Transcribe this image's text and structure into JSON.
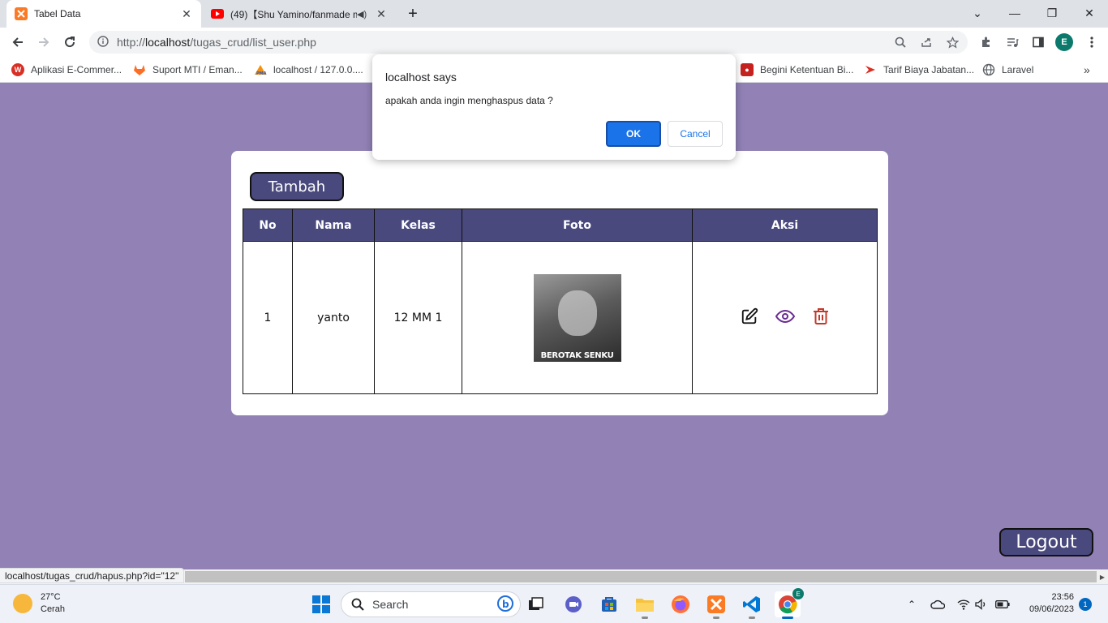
{
  "browser": {
    "tabs": [
      {
        "title": "Tabel Data",
        "favicon": "xampp-icon",
        "active": true
      },
      {
        "title": "(49)【Shu Yamino/fanmade m",
        "favicon": "youtube-icon",
        "active": false
      }
    ],
    "address": {
      "prefix": "http://",
      "host": "localhost",
      "path": "/tugas_crud/list_user.php"
    },
    "profile_initial": "E",
    "bookmarks": [
      {
        "label": "Aplikasi E-Commer...",
        "icon": "ecommerce-icon",
        "color": "#d93025"
      },
      {
        "label": "Suport MTI / Eman...",
        "icon": "gitlab-icon",
        "color": "#fc6d26"
      },
      {
        "label": "localhost / 127.0.0....",
        "icon": "phpmyadmin-icon",
        "color": "#f29111"
      },
      {
        "label": "Begini Ketentuan Bi...",
        "icon": "news-icon",
        "color": "#c5221f"
      },
      {
        "label": "Tarif Biaya Jabatan...",
        "icon": "arrow-bookmark-icon",
        "color": "#d93025"
      },
      {
        "label": "Laravel",
        "icon": "globe-icon",
        "color": "#5f6368"
      }
    ]
  },
  "dialog": {
    "title": "localhost says",
    "message": "apakah anda ingin menghaspus data ?",
    "ok_label": "OK",
    "cancel_label": "Cancel"
  },
  "page": {
    "add_button": "Tambah",
    "logout_button": "Logout",
    "table": {
      "headers": [
        "No",
        "Nama",
        "Kelas",
        "Foto",
        "Aksi"
      ],
      "rows": [
        {
          "no": "1",
          "nama": "yanto",
          "kelas": "12 MM 1",
          "photo_caption": "BEROTAK SENKU"
        }
      ]
    },
    "colors": {
      "background": "#9181b5",
      "accent": "#49497e",
      "view_icon": "#6a2c91",
      "delete_icon": "#c0392b"
    }
  },
  "status_bar": {
    "hover_url": "localhost/tugas_crud/hapus.php?id=\"12\""
  },
  "taskbar": {
    "weather_temp": "27°C",
    "weather_desc": "Cerah",
    "search_label": "Search",
    "time": "23:56",
    "date": "09/06/2023",
    "notification_count": "1"
  }
}
